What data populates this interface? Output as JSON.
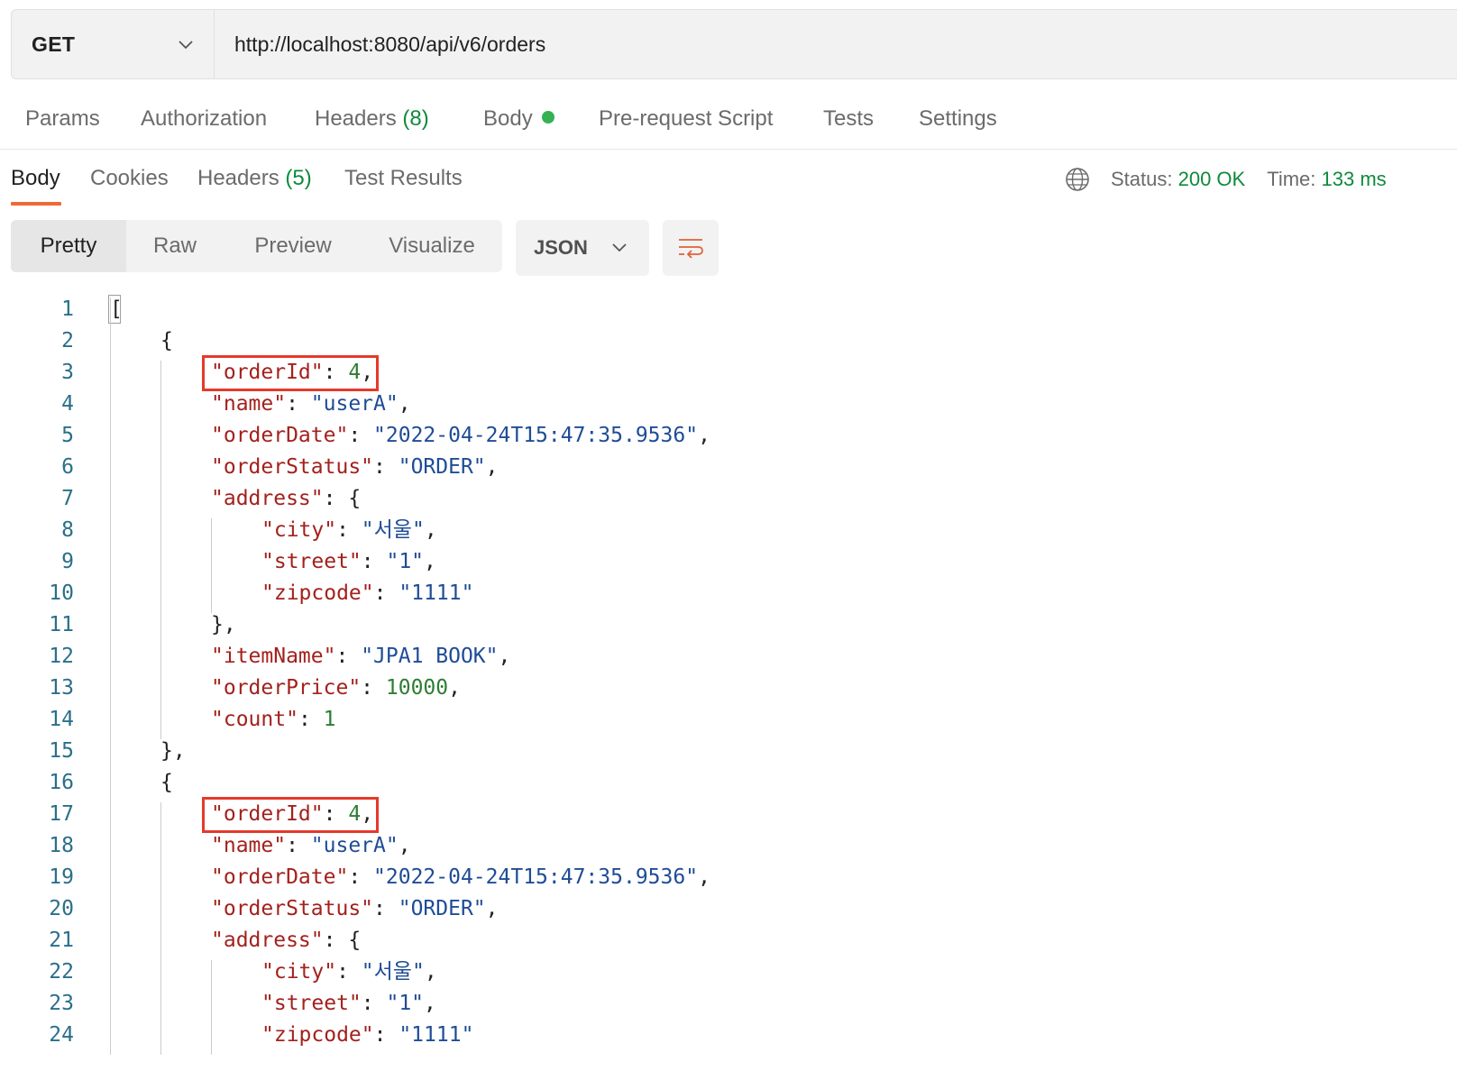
{
  "request": {
    "method": "GET",
    "url": "http://localhost:8080/api/v6/orders"
  },
  "request_tabs": {
    "params": "Params",
    "authorization": "Authorization",
    "headers": "Headers",
    "headers_count": "(8)",
    "body": "Body",
    "prerequest": "Pre-request Script",
    "tests": "Tests",
    "settings": "Settings"
  },
  "response_tabs": {
    "body": "Body",
    "cookies": "Cookies",
    "headers": "Headers",
    "headers_count": "(5)",
    "test_results": "Test Results"
  },
  "status": {
    "status_label": "Status:",
    "status_value": "200 OK",
    "time_label": "Time:",
    "time_value": "133 ms"
  },
  "format": {
    "pretty": "Pretty",
    "raw": "Raw",
    "preview": "Preview",
    "visualize": "Visualize",
    "language": "JSON"
  },
  "code_lines": [
    {
      "num": "1",
      "indent": 0,
      "parts": [
        [
          "p",
          "["
        ]
      ]
    },
    {
      "num": "2",
      "indent": 1,
      "parts": [
        [
          "p",
          "{"
        ]
      ]
    },
    {
      "num": "3",
      "indent": 2,
      "parts": [
        [
          "k",
          "\"orderId\""
        ],
        [
          "p",
          ": "
        ],
        [
          "n",
          "4"
        ],
        [
          "p",
          ","
        ]
      ]
    },
    {
      "num": "4",
      "indent": 2,
      "parts": [
        [
          "k",
          "\"name\""
        ],
        [
          "p",
          ": "
        ],
        [
          "s",
          "\"userA\""
        ],
        [
          "p",
          ","
        ]
      ]
    },
    {
      "num": "5",
      "indent": 2,
      "parts": [
        [
          "k",
          "\"orderDate\""
        ],
        [
          "p",
          ": "
        ],
        [
          "s",
          "\"2022-04-24T15:47:35.9536\""
        ],
        [
          "p",
          ","
        ]
      ]
    },
    {
      "num": "6",
      "indent": 2,
      "parts": [
        [
          "k",
          "\"orderStatus\""
        ],
        [
          "p",
          ": "
        ],
        [
          "s",
          "\"ORDER\""
        ],
        [
          "p",
          ","
        ]
      ]
    },
    {
      "num": "7",
      "indent": 2,
      "parts": [
        [
          "k",
          "\"address\""
        ],
        [
          "p",
          ": {"
        ]
      ]
    },
    {
      "num": "8",
      "indent": 3,
      "parts": [
        [
          "k",
          "\"city\""
        ],
        [
          "p",
          ": "
        ],
        [
          "s",
          "\"서울\""
        ],
        [
          "p",
          ","
        ]
      ]
    },
    {
      "num": "9",
      "indent": 3,
      "parts": [
        [
          "k",
          "\"street\""
        ],
        [
          "p",
          ": "
        ],
        [
          "s",
          "\"1\""
        ],
        [
          "p",
          ","
        ]
      ]
    },
    {
      "num": "10",
      "indent": 3,
      "parts": [
        [
          "k",
          "\"zipcode\""
        ],
        [
          "p",
          ": "
        ],
        [
          "s",
          "\"1111\""
        ]
      ]
    },
    {
      "num": "11",
      "indent": 2,
      "parts": [
        [
          "p",
          "},"
        ]
      ]
    },
    {
      "num": "12",
      "indent": 2,
      "parts": [
        [
          "k",
          "\"itemName\""
        ],
        [
          "p",
          ": "
        ],
        [
          "s",
          "\"JPA1 BOOK\""
        ],
        [
          "p",
          ","
        ]
      ]
    },
    {
      "num": "13",
      "indent": 2,
      "parts": [
        [
          "k",
          "\"orderPrice\""
        ],
        [
          "p",
          ": "
        ],
        [
          "n",
          "10000"
        ],
        [
          "p",
          ","
        ]
      ]
    },
    {
      "num": "14",
      "indent": 2,
      "parts": [
        [
          "k",
          "\"count\""
        ],
        [
          "p",
          ": "
        ],
        [
          "n",
          "1"
        ]
      ]
    },
    {
      "num": "15",
      "indent": 1,
      "parts": [
        [
          "p",
          "},"
        ]
      ]
    },
    {
      "num": "16",
      "indent": 1,
      "parts": [
        [
          "p",
          "{"
        ]
      ]
    },
    {
      "num": "17",
      "indent": 2,
      "parts": [
        [
          "k",
          "\"orderId\""
        ],
        [
          "p",
          ": "
        ],
        [
          "n",
          "4"
        ],
        [
          "p",
          ","
        ]
      ]
    },
    {
      "num": "18",
      "indent": 2,
      "parts": [
        [
          "k",
          "\"name\""
        ],
        [
          "p",
          ": "
        ],
        [
          "s",
          "\"userA\""
        ],
        [
          "p",
          ","
        ]
      ]
    },
    {
      "num": "19",
      "indent": 2,
      "parts": [
        [
          "k",
          "\"orderDate\""
        ],
        [
          "p",
          ": "
        ],
        [
          "s",
          "\"2022-04-24T15:47:35.9536\""
        ],
        [
          "p",
          ","
        ]
      ]
    },
    {
      "num": "20",
      "indent": 2,
      "parts": [
        [
          "k",
          "\"orderStatus\""
        ],
        [
          "p",
          ": "
        ],
        [
          "s",
          "\"ORDER\""
        ],
        [
          "p",
          ","
        ]
      ]
    },
    {
      "num": "21",
      "indent": 2,
      "parts": [
        [
          "k",
          "\"address\""
        ],
        [
          "p",
          ": {"
        ]
      ]
    },
    {
      "num": "22",
      "indent": 3,
      "parts": [
        [
          "k",
          "\"city\""
        ],
        [
          "p",
          ": "
        ],
        [
          "s",
          "\"서울\""
        ],
        [
          "p",
          ","
        ]
      ]
    },
    {
      "num": "23",
      "indent": 3,
      "parts": [
        [
          "k",
          "\"street\""
        ],
        [
          "p",
          ": "
        ],
        [
          "s",
          "\"1\""
        ],
        [
          "p",
          ","
        ]
      ]
    },
    {
      "num": "24",
      "indent": 3,
      "parts": [
        [
          "k",
          "\"zipcode\""
        ],
        [
          "p",
          ": "
        ],
        [
          "s",
          "\"1111\""
        ]
      ]
    }
  ],
  "highlighted_lines": [
    "3",
    "17"
  ],
  "colors": {
    "accent": "#ef6a37",
    "status_green": "#0f8a3c",
    "highlight_red": "#e5392b",
    "json_key": "#a3211d",
    "json_string": "#1f4c96",
    "json_number": "#2e7d32"
  },
  "icons": {
    "method_dropdown": "chevron-down-icon",
    "language_dropdown": "chevron-down-icon",
    "network": "globe-icon",
    "wrap": "text-wrap-icon"
  }
}
